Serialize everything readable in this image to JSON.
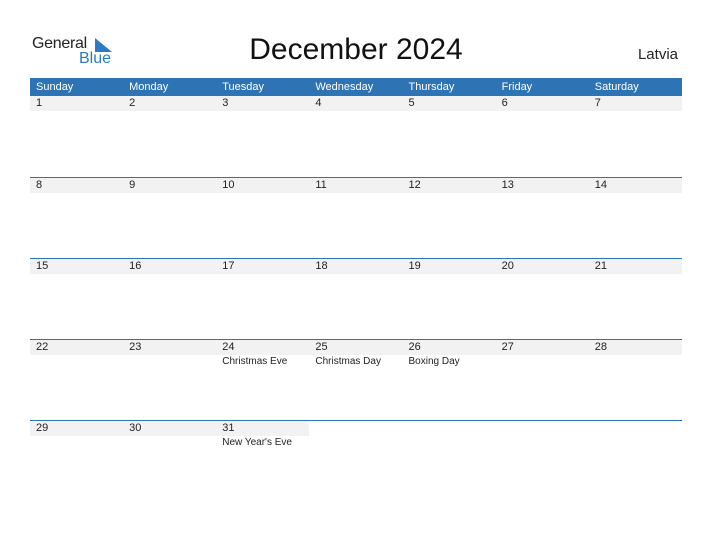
{
  "logo": {
    "general": "General",
    "blue": "Blue",
    "icon": "triangle-flag-icon",
    "accent": "#2a7bc4"
  },
  "title": "December 2024",
  "country": "Latvia",
  "header_color": "#2e74b5",
  "weekdays": [
    "Sunday",
    "Monday",
    "Tuesday",
    "Wednesday",
    "Thursday",
    "Friday",
    "Saturday"
  ],
  "weeks": [
    [
      {
        "d": "1",
        "h": ""
      },
      {
        "d": "2",
        "h": ""
      },
      {
        "d": "3",
        "h": ""
      },
      {
        "d": "4",
        "h": ""
      },
      {
        "d": "5",
        "h": ""
      },
      {
        "d": "6",
        "h": ""
      },
      {
        "d": "7",
        "h": ""
      }
    ],
    [
      {
        "d": "8",
        "h": ""
      },
      {
        "d": "9",
        "h": ""
      },
      {
        "d": "10",
        "h": ""
      },
      {
        "d": "11",
        "h": ""
      },
      {
        "d": "12",
        "h": ""
      },
      {
        "d": "13",
        "h": ""
      },
      {
        "d": "14",
        "h": ""
      }
    ],
    [
      {
        "d": "15",
        "h": ""
      },
      {
        "d": "16",
        "h": ""
      },
      {
        "d": "17",
        "h": ""
      },
      {
        "d": "18",
        "h": ""
      },
      {
        "d": "19",
        "h": ""
      },
      {
        "d": "20",
        "h": ""
      },
      {
        "d": "21",
        "h": ""
      }
    ],
    [
      {
        "d": "22",
        "h": ""
      },
      {
        "d": "23",
        "h": ""
      },
      {
        "d": "24",
        "h": "Christmas Eve"
      },
      {
        "d": "25",
        "h": "Christmas Day"
      },
      {
        "d": "26",
        "h": "Boxing Day"
      },
      {
        "d": "27",
        "h": ""
      },
      {
        "d": "28",
        "h": ""
      }
    ],
    [
      {
        "d": "29",
        "h": ""
      },
      {
        "d": "30",
        "h": ""
      },
      {
        "d": "31",
        "h": "New Year's Eve"
      },
      {
        "d": "",
        "h": ""
      },
      {
        "d": "",
        "h": ""
      },
      {
        "d": "",
        "h": ""
      },
      {
        "d": "",
        "h": ""
      }
    ]
  ]
}
